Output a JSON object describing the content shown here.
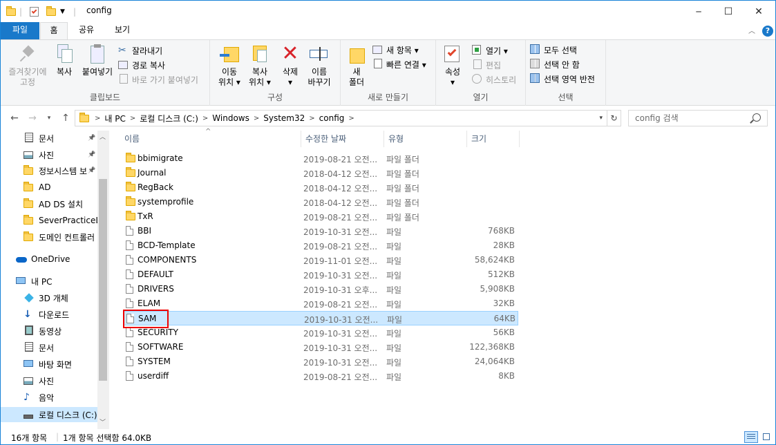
{
  "window": {
    "title": "config",
    "controls": {
      "minimize": "─",
      "maximize": "☐",
      "close": "✕"
    }
  },
  "ribbon_tabs": {
    "file": "파일",
    "home": "홈",
    "share": "공유",
    "view": "보기"
  },
  "ribbon": {
    "clipboard": {
      "label": "클립보드",
      "pin_quick": [
        "즐겨찾기에",
        "고정"
      ],
      "copy": "복사",
      "paste": "붙여넣기",
      "cut": "잘라내기",
      "copy_path": "경로 복사",
      "paste_shortcut": "바로 가기 붙여넣기"
    },
    "organize": {
      "label": "구성",
      "move_to": [
        "이동",
        "위치 ▾"
      ],
      "copy_to": [
        "복사",
        "위치 ▾"
      ],
      "delete": [
        "삭제",
        "▾"
      ],
      "rename": [
        "이름",
        "바꾸기"
      ]
    },
    "new": {
      "label": "새로 만들기",
      "new_folder": [
        "새",
        "폴더"
      ],
      "new_item": "새 항목 ▾",
      "easy_access": "빠른 연결 ▾"
    },
    "open": {
      "label": "열기",
      "properties": [
        "속성",
        "▾"
      ],
      "open": "열기 ▾",
      "edit": "편집",
      "history": "히스토리"
    },
    "select": {
      "label": "선택",
      "select_all": "모두 선택",
      "select_none": "선택 안 함",
      "invert": "선택 영역 반전"
    }
  },
  "address": {
    "crumbs": [
      "내 PC",
      "로컬 디스크 (C:)",
      "Windows",
      "System32",
      "config"
    ],
    "search_placeholder": "config 검색"
  },
  "nav": [
    {
      "label": "문서",
      "icon": "documents-icon",
      "pinned": true
    },
    {
      "label": "사진",
      "icon": "pictures-icon",
      "pinned": true
    },
    {
      "label": "정보시스템 보",
      "icon": "folder-icon",
      "pinned": true
    },
    {
      "label": "AD",
      "icon": "folder-icon",
      "pinned": false
    },
    {
      "label": "AD DS 설치",
      "icon": "folder-icon",
      "pinned": false
    },
    {
      "label": "SeverPracticeLA",
      "icon": "folder-icon",
      "pinned": false
    },
    {
      "label": "도메인 컨트롤러",
      "icon": "folder-icon",
      "pinned": false
    },
    {
      "label": "OneDrive",
      "icon": "onedrive-icon",
      "pinned": false
    },
    {
      "label": "내 PC",
      "icon": "this-pc-icon",
      "pinned": false
    },
    {
      "label": "3D 개체",
      "icon": "3d-objects-icon",
      "pinned": false
    },
    {
      "label": "다운로드",
      "icon": "downloads-icon",
      "pinned": false
    },
    {
      "label": "동영상",
      "icon": "videos-icon",
      "pinned": false
    },
    {
      "label": "문서",
      "icon": "documents-icon",
      "pinned": false
    },
    {
      "label": "바탕 화면",
      "icon": "desktop-icon",
      "pinned": false
    },
    {
      "label": "사진",
      "icon": "pictures-icon",
      "pinned": false
    },
    {
      "label": "음악",
      "icon": "music-icon",
      "pinned": false
    },
    {
      "label": "로컬 디스크 (C:)",
      "icon": "drive-icon",
      "pinned": false
    }
  ],
  "columns": {
    "name": "이름",
    "modified": "수정한 날짜",
    "type": "유형",
    "size": "크기"
  },
  "files": [
    {
      "name": "bbimigrate",
      "date": "2019-08-21 오전...",
      "type": "파일 폴더",
      "size": "",
      "folder": true
    },
    {
      "name": "Journal",
      "date": "2018-04-12 오전...",
      "type": "파일 폴더",
      "size": "",
      "folder": true
    },
    {
      "name": "RegBack",
      "date": "2018-04-12 오전...",
      "type": "파일 폴더",
      "size": "",
      "folder": true
    },
    {
      "name": "systemprofile",
      "date": "2018-04-12 오전...",
      "type": "파일 폴더",
      "size": "",
      "folder": true
    },
    {
      "name": "TxR",
      "date": "2019-08-21 오전...",
      "type": "파일 폴더",
      "size": "",
      "folder": true
    },
    {
      "name": "BBI",
      "date": "2019-10-31 오전...",
      "type": "파일",
      "size": "768KB",
      "folder": false
    },
    {
      "name": "BCD-Template",
      "date": "2019-08-21 오전...",
      "type": "파일",
      "size": "28KB",
      "folder": false
    },
    {
      "name": "COMPONENTS",
      "date": "2019-11-01 오전...",
      "type": "파일",
      "size": "58,624KB",
      "folder": false
    },
    {
      "name": "DEFAULT",
      "date": "2019-10-31 오전...",
      "type": "파일",
      "size": "512KB",
      "folder": false
    },
    {
      "name": "DRIVERS",
      "date": "2019-10-31 오후...",
      "type": "파일",
      "size": "5,908KB",
      "folder": false
    },
    {
      "name": "ELAM",
      "date": "2019-08-21 오전...",
      "type": "파일",
      "size": "32KB",
      "folder": false
    },
    {
      "name": "SAM",
      "date": "2019-10-31 오전...",
      "type": "파일",
      "size": "64KB",
      "folder": false
    },
    {
      "name": "SECURITY",
      "date": "2019-10-31 오전...",
      "type": "파일",
      "size": "56KB",
      "folder": false
    },
    {
      "name": "SOFTWARE",
      "date": "2019-10-31 오전...",
      "type": "파일",
      "size": "122,368KB",
      "folder": false
    },
    {
      "name": "SYSTEM",
      "date": "2019-10-31 오전...",
      "type": "파일",
      "size": "24,064KB",
      "folder": false
    },
    {
      "name": "userdiff",
      "date": "2019-08-21 오전...",
      "type": "파일",
      "size": "8KB",
      "folder": false
    }
  ],
  "selected_file": "SAM",
  "status": {
    "count": "16개 항목",
    "selection": "1개 항목 선택함 64.0KB"
  },
  "colors": {
    "accent": "#1979ca",
    "selection": "#cce8ff",
    "highlight_box": "#ee0000"
  }
}
